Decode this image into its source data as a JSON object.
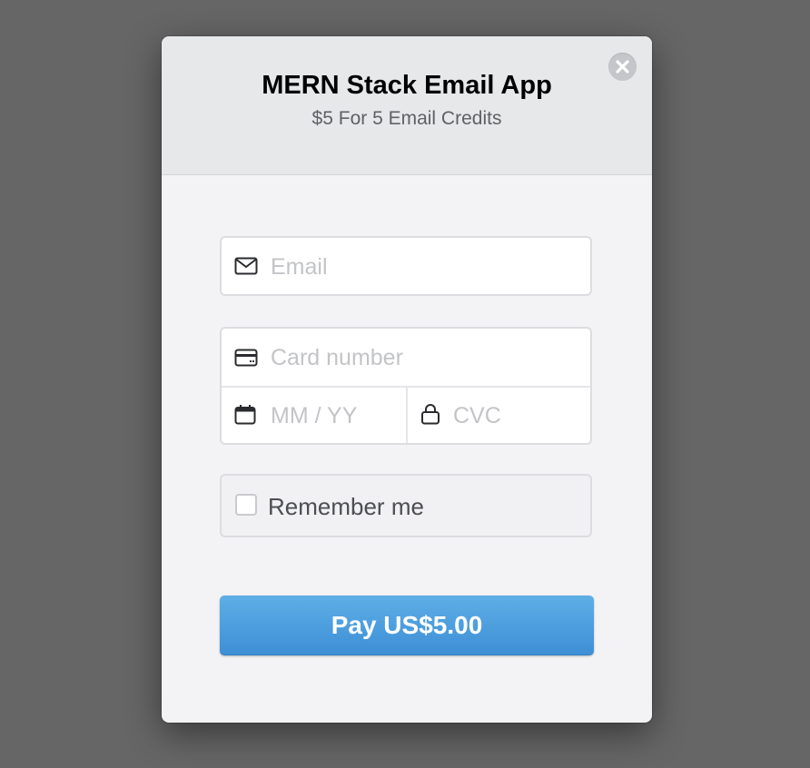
{
  "modal": {
    "title": "MERN Stack Email App",
    "subtitle": "$5 For 5 Email Credits",
    "close_icon": "close-icon"
  },
  "form": {
    "email": {
      "placeholder": "Email",
      "icon": "envelope-icon"
    },
    "card_number": {
      "placeholder": "Card number",
      "icon": "credit-card-icon"
    },
    "expiry": {
      "placeholder": "MM / YY",
      "icon": "calendar-icon"
    },
    "cvc": {
      "placeholder": "CVC",
      "icon": "lock-icon"
    },
    "remember": {
      "label": "Remember me",
      "checked": false
    },
    "pay_label": "Pay US$5.00"
  },
  "colors": {
    "backdrop": "#666666",
    "pay_button": "#4a9de0",
    "header_bg": "#e7e8ea"
  }
}
